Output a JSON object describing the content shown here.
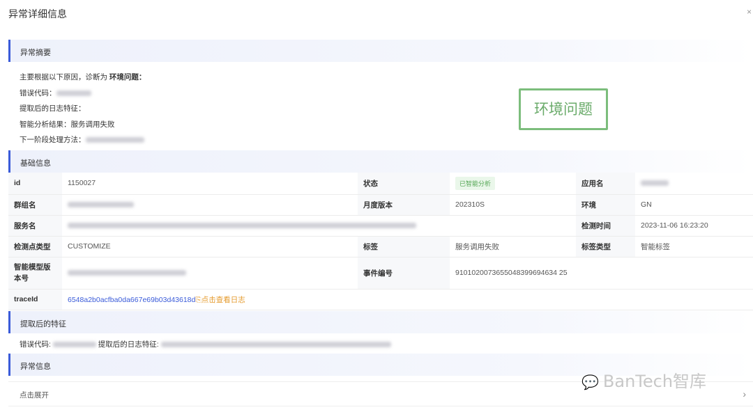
{
  "modal": {
    "title": "异常详细信息",
    "close": "×"
  },
  "sections": {
    "summary": "异常摘要",
    "basic": "基础信息",
    "extracted": "提取后的特征",
    "exception": "异常信息"
  },
  "summary": {
    "line1_prefix": "主要根据以下原因，诊断为 ",
    "line1_bold": "环境问题：",
    "error_code_label": "错误代码：",
    "log_feature_label": "提取后的日志特征：",
    "analysis_label": "智能分析结果：",
    "analysis_value": "服务调用失败",
    "next_step_label": "下一阶段处理方法："
  },
  "stamp": "环境问题",
  "basic": {
    "id_k": "id",
    "id_v": "1150027",
    "status_k": "状态",
    "status_v": "已智能分析",
    "app_k": "应用名",
    "group_k": "群组名",
    "month_k": "月度版本",
    "month_v": "202310S",
    "env_k": "环境",
    "env_v": "GN",
    "service_k": "服务名",
    "detect_time_k": "检测时间",
    "detect_time_v": "2023-11-06 16:23:20",
    "checkpoint_k": "检测点类型",
    "checkpoint_v": "CUSTOMIZE",
    "tag_k": "标签",
    "tag_v": "服务调用失败",
    "tag_type_k": "标签类型",
    "tag_type_v": "智能标签",
    "model_k": "智能模型版本号",
    "event_k": "事件编号",
    "event_v": "9101020073655048399694634 25",
    "trace_k": "traceId",
    "trace_v": "6548a2b0acfba0da667e69b03d43618d",
    "log_link": "点击查看日志"
  },
  "extracted": {
    "error_code_label": "错误代码: ",
    "log_feature_label": "提取后的日志特征: "
  },
  "exception": {
    "expand": "点击展开"
  },
  "watermark": "BanTech智库"
}
